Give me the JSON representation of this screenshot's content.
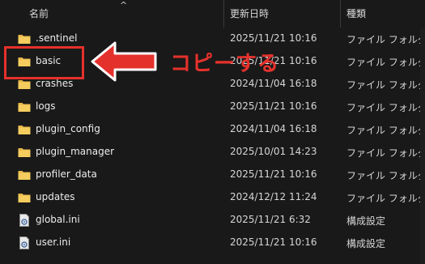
{
  "columns": {
    "name": "名前",
    "date": "更新日時",
    "type": "種類"
  },
  "rows": [
    {
      "name": ".sentinel",
      "date": "2025/11/21 10:16",
      "type": "ファイル フォルダー",
      "icon": "folder-icon"
    },
    {
      "name": "basic",
      "date": "2025/11/21 10:16",
      "type": "ファイル フォルダー",
      "icon": "folder-icon"
    },
    {
      "name": "crashes",
      "date": "2024/11/04 16:18",
      "type": "ファイル フォルダー",
      "icon": "folder-icon"
    },
    {
      "name": "logs",
      "date": "2025/11/21 10:16",
      "type": "ファイル フォルダー",
      "icon": "folder-icon"
    },
    {
      "name": "plugin_config",
      "date": "2024/11/04 16:18",
      "type": "ファイル フォルダー",
      "icon": "folder-icon"
    },
    {
      "name": "plugin_manager",
      "date": "2025/10/01 14:23",
      "type": "ファイル フォルダー",
      "icon": "folder-icon"
    },
    {
      "name": "profiler_data",
      "date": "2025/11/21 10:16",
      "type": "ファイル フォルダー",
      "icon": "folder-icon"
    },
    {
      "name": "updates",
      "date": "2024/12/12 11:24",
      "type": "ファイル フォルダー",
      "icon": "folder-icon"
    },
    {
      "name": "global.ini",
      "date": "2025/11/21 6:32",
      "type": "構成設定",
      "icon": "settings-file-icon"
    },
    {
      "name": "user.ini",
      "date": "2025/11/21 10:16",
      "type": "構成設定",
      "icon": "settings-file-icon"
    }
  ],
  "annotation": {
    "text": "コピーする",
    "color": "#e5312c"
  }
}
